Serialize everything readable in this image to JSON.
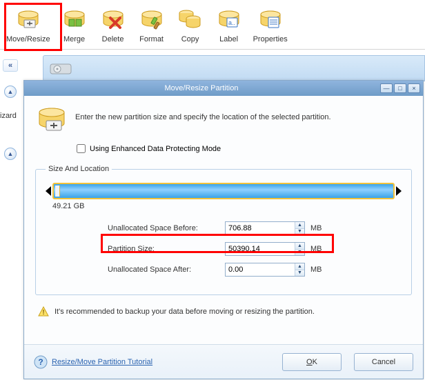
{
  "toolbar": [
    {
      "label": "Move/Resize",
      "icon": "move-resize"
    },
    {
      "label": "Merge",
      "icon": "merge"
    },
    {
      "label": "Delete",
      "icon": "delete"
    },
    {
      "label": "Format",
      "icon": "format"
    },
    {
      "label": "Copy",
      "icon": "copy"
    },
    {
      "label": "Label",
      "icon": "label"
    },
    {
      "label": "Properties",
      "icon": "properties"
    }
  ],
  "sidebar": {
    "wizard_label": "izard"
  },
  "dialog": {
    "title": "Move/Resize Partition",
    "instruction": "Enter the new partition size and specify the location of the selected partition.",
    "enhanced_label": "Using Enhanced Data Protecting Mode",
    "enhanced_checked": false,
    "size_location_legend": "Size And Location",
    "partition_size_text": "49.21 GB",
    "fields": {
      "before_label": "Unallocated Space Before:",
      "before_value": "706.88",
      "before_unit": "MB",
      "size_label": "Partition Size:",
      "size_value": "50390.14",
      "size_unit": "MB",
      "after_label": "Unallocated Space After:",
      "after_value": "0.00",
      "after_unit": "MB"
    },
    "warning": "It's recommended to backup your data before moving or resizing the partition.",
    "tutorial_link": "Resize/Move Partition Tutorial",
    "ok_label": "OK",
    "cancel_label": "Cancel"
  }
}
